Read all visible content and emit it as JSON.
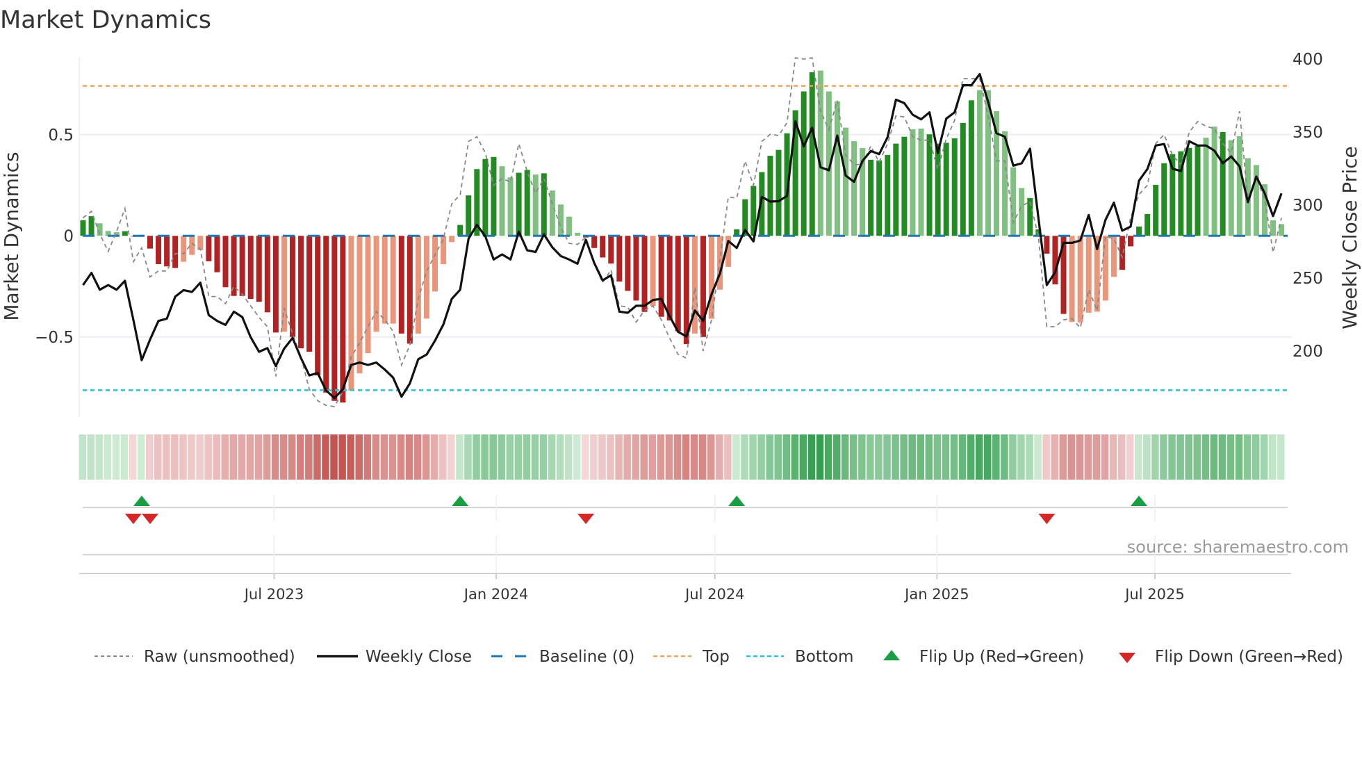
{
  "chart_data": {
    "type": "bar",
    "title": "Market Dynamics",
    "ylabel": "Market Dynamics",
    "y2label": "Weekly Close Price",
    "ylim": [
      -0.88,
      0.88
    ],
    "y2lim": [
      160,
      400
    ],
    "yticks": [
      {
        "value": 0.5,
        "label": "0.5"
      },
      {
        "value": 0,
        "label": "0"
      },
      {
        "value": -0.5,
        "label": "−0.5"
      }
    ],
    "y2ticks": [
      {
        "value": 400,
        "label": "400"
      },
      {
        "value": 350,
        "label": "350"
      },
      {
        "value": 300,
        "label": "300"
      },
      {
        "value": 250,
        "label": "250"
      },
      {
        "value": 200,
        "label": "200"
      }
    ],
    "xticks": [
      {
        "week": 22.8,
        "label": "Jul 2023"
      },
      {
        "week": 49.3,
        "label": "Jan 2024"
      },
      {
        "week": 75.4,
        "label": "Jul 2024"
      },
      {
        "week": 101.9,
        "label": "Jan 2025"
      },
      {
        "week": 127.9,
        "label": "Jul 2025"
      }
    ],
    "levels": {
      "top": 0.741,
      "bottom": -0.763,
      "baseline": 0
    },
    "values": [
      0.077,
      0.097,
      0.062,
      0.024,
      0.018,
      0.023,
      -0.005,
      0.005,
      -0.063,
      -0.14,
      -0.151,
      -0.159,
      -0.128,
      -0.094,
      -0.071,
      -0.126,
      -0.18,
      -0.254,
      -0.297,
      -0.297,
      -0.312,
      -0.326,
      -0.378,
      -0.478,
      -0.474,
      -0.5,
      -0.556,
      -0.573,
      -0.69,
      -0.775,
      -0.816,
      -0.824,
      -0.765,
      -0.68,
      -0.58,
      -0.474,
      -0.434,
      -0.434,
      -0.483,
      -0.533,
      -0.483,
      -0.409,
      -0.275,
      -0.14,
      -0.031,
      0.054,
      0.2,
      0.33,
      0.38,
      0.39,
      0.344,
      0.289,
      0.312,
      0.326,
      0.303,
      0.309,
      0.224,
      0.155,
      0.095,
      0.015,
      -0.008,
      -0.06,
      -0.107,
      -0.137,
      -0.226,
      -0.272,
      -0.32,
      -0.376,
      -0.346,
      -0.4,
      -0.418,
      -0.472,
      -0.535,
      -0.483,
      -0.5,
      -0.41,
      -0.266,
      -0.153,
      0.032,
      0.181,
      0.247,
      0.315,
      0.396,
      0.425,
      0.507,
      0.621,
      0.714,
      0.809,
      0.817,
      0.714,
      0.665,
      0.535,
      0.468,
      0.434,
      0.376,
      0.373,
      0.4,
      0.456,
      0.49,
      0.527,
      0.53,
      0.502,
      0.456,
      0.46,
      0.482,
      0.558,
      0.67,
      0.72,
      0.72,
      0.616,
      0.517,
      0.339,
      0.236,
      0.187,
      0.032,
      -0.088,
      -0.24,
      -0.386,
      -0.426,
      -0.428,
      -0.38,
      -0.375,
      -0.32,
      -0.203,
      -0.168,
      -0.052,
      0.046,
      0.108,
      0.252,
      0.359,
      0.404,
      0.418,
      0.435,
      0.444,
      0.485,
      0.54,
      0.513,
      0.473,
      0.493,
      0.384,
      0.35,
      0.255,
      0.077,
      0.058
    ],
    "strengthening": "110001011111000111111111011111110000001100000111110011010000111111110111101000111111111100000011111001111110000001111100000011111111110010 0000",
    "raw": [
      0.089,
      0.121,
      0.009,
      -0.077,
      0.021,
      0.135,
      -0.128,
      -0.059,
      -0.203,
      -0.174,
      -0.174,
      -0.088,
      -0.088,
      -0.037,
      -0.065,
      -0.3,
      -0.3,
      -0.335,
      -0.249,
      -0.289,
      -0.346,
      -0.403,
      -0.449,
      -0.695,
      -0.357,
      -0.483,
      -0.598,
      -0.758,
      -0.815,
      -0.838,
      -0.844,
      -0.77,
      -0.598,
      -0.53,
      -0.449,
      -0.374,
      -0.414,
      -0.472,
      -0.638,
      -0.541,
      -0.312,
      -0.174,
      -0.094,
      -0.014,
      0.158,
      0.204,
      0.467,
      0.49,
      0.41,
      0.249,
      0.284,
      0.266,
      0.456,
      0.318,
      0.21,
      0.284,
      0.158,
      0.044,
      -0.037,
      -0.042,
      -0.008,
      -0.14,
      -0.231,
      -0.168,
      -0.346,
      -0.352,
      -0.426,
      -0.369,
      -0.346,
      -0.415,
      -0.506,
      -0.586,
      -0.604,
      -0.254,
      -0.569,
      -0.415,
      -0.117,
      0.192,
      0.187,
      0.37,
      0.25,
      0.467,
      0.502,
      0.496,
      0.559,
      0.88,
      0.874,
      0.88,
      0.616,
      0.525,
      0.668,
      0.399,
      0.353,
      0.353,
      0.444,
      0.364,
      0.456,
      0.593,
      0.588,
      0.49,
      0.473,
      0.473,
      0.33,
      0.479,
      0.57,
      0.777,
      0.777,
      0.777,
      0.593,
      0.37,
      0.37,
      0.066,
      0.147,
      0.17,
      -0.002,
      -0.449,
      -0.449,
      -0.415,
      -0.409,
      -0.455,
      -0.266,
      -0.369,
      -0.002,
      -0.014,
      -0.105,
      0.089,
      0.204,
      0.25,
      0.456,
      0.501,
      0.398,
      0.353,
      0.513,
      0.565,
      0.542,
      0.53,
      0.456,
      0.41,
      0.616,
      0.181,
      0.284,
      0.181,
      -0.082,
      0.089
    ],
    "close": [
      245.2,
      253.5,
      242,
      245.2,
      242,
      248.1,
      221.4,
      193.7,
      207.9,
      220.6,
      222.2,
      237.3,
      241.7,
      240.5,
      246.8,
      224.6,
      220.6,
      217.9,
      227,
      223.3,
      209.5,
      199.5,
      202,
      189.7,
      201.6,
      209,
      195.2,
      183.3,
      184.9,
      173,
      167.8,
      173.8,
      190.5,
      192.1,
      190.5,
      192.1,
      187.3,
      181.8,
      168.7,
      177.8,
      194.4,
      197.6,
      207.1,
      218.3,
      235.7,
      242,
      277,
      286.5,
      278.6,
      262.7,
      266.2,
      262.7,
      281.8,
      269,
      267.8,
      279.9,
      271,
      265.1,
      262.7,
      259.8,
      276.2,
      260.3,
      248.4,
      251.9,
      227,
      226.2,
      231,
      231,
      234.9,
      235.7,
      223.8,
      213.2,
      210,
      227.8,
      220.6,
      238.9,
      253.2,
      275.4,
      270.6,
      283,
      275.1,
      305.6,
      302.4,
      302.6,
      306.3,
      357.5,
      340.2,
      352.9,
      325.9,
      323.8,
      347.6,
      320.2,
      315.9,
      330.2,
      337,
      334.9,
      346.5,
      372.2,
      369.8,
      361.9,
      358.7,
      363.5,
      335.7,
      359.2,
      363.5,
      382.1,
      382.1,
      389.7,
      370.6,
      349.2,
      346.8,
      327,
      328.6,
      338.6,
      291.3,
      245.2,
      254,
      274.1,
      274.1,
      275.7,
      293.2,
      269.8,
      289.7,
      301.6,
      282.5,
      285.2,
      316.7,
      324.6,
      340.8,
      341.8,
      324.9,
      323.3,
      343.7,
      340.8,
      340.8,
      337.3,
      328.6,
      333.3,
      326.5,
      302,
      319.5,
      308,
      292.5,
      308
    ],
    "flips": {
      "up": [
        7,
        45,
        78,
        126
      ],
      "down": [
        6,
        8,
        60,
        115
      ]
    },
    "legend": {
      "placement": "bottom",
      "entries": [
        "Raw (unsmoothed)",
        "Weekly Close",
        "Baseline (0)",
        "Top",
        "Bottom",
        "Flip Up (Red→Green)",
        "Flip Down (Green→Red)"
      ]
    },
    "source": "source: sharemaestro.com"
  },
  "colors": {
    "strong_green": "#228b22",
    "weak_green": "#80c080",
    "strong_red": "#b22222",
    "weak_red": "#e9967a",
    "close": "#111111",
    "raw": "#888888",
    "baseline": "#1f77b4",
    "top": "#f0a35a",
    "bottom": "#22c4d8",
    "flip_up": "#1a9e44",
    "flip_down": "#d62728"
  }
}
